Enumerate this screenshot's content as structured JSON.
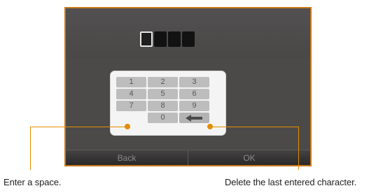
{
  "pin": {
    "slots": 4,
    "filled": 0
  },
  "keypad": {
    "rows": [
      [
        "1",
        "2",
        "3"
      ],
      [
        "4",
        "5",
        "6"
      ],
      [
        "7",
        "8",
        "9"
      ],
      [
        "",
        "0",
        ""
      ]
    ]
  },
  "softkeys": {
    "left": "Back",
    "right": "OK"
  },
  "captions": {
    "space": "Enter a space.",
    "delete": "Delete the last entered character."
  },
  "colors": {
    "callout": "#e58d00",
    "frame": "#c97a1a"
  },
  "icons": {
    "delete_key": "backspace-arrow-icon"
  }
}
